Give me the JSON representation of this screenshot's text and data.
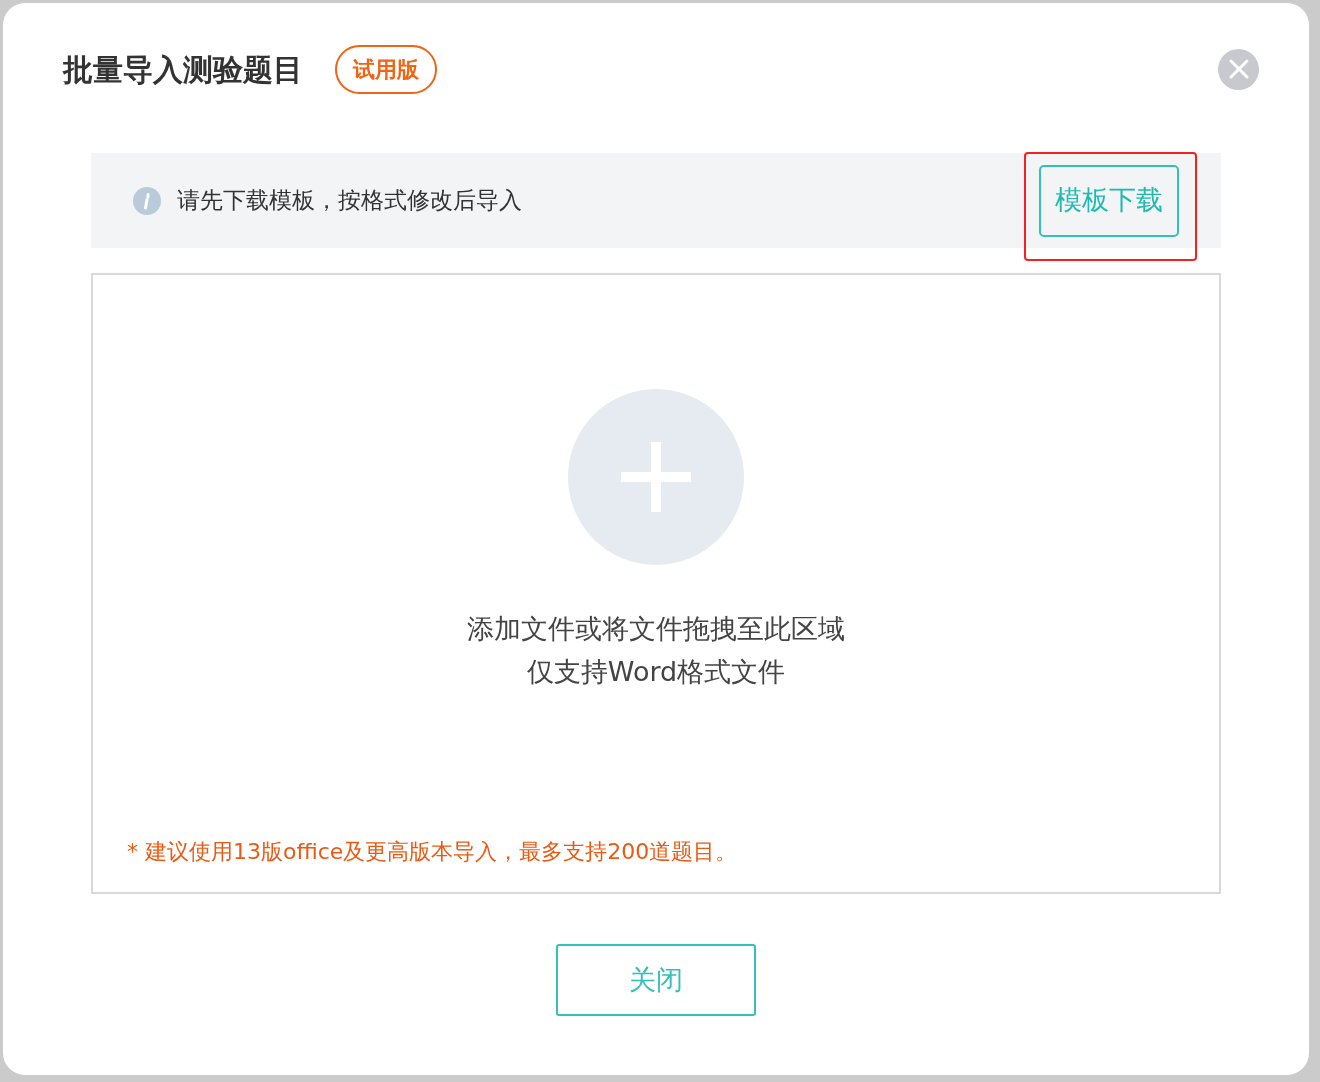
{
  "dialog": {
    "title": "批量导入测验题目",
    "badge": "试用版"
  },
  "notice": {
    "text": "请先下载模板，按格式修改后导入",
    "button": "模板下载",
    "highlighted": true
  },
  "dropzone": {
    "line_1": "添加文件或将文件拖拽至此区域",
    "line_2": "仅支持Word格式文件",
    "note": "* 建议使用13版office及更高版本导入，最多支持200道题目。"
  },
  "buttons": [
    "关闭"
  ]
}
